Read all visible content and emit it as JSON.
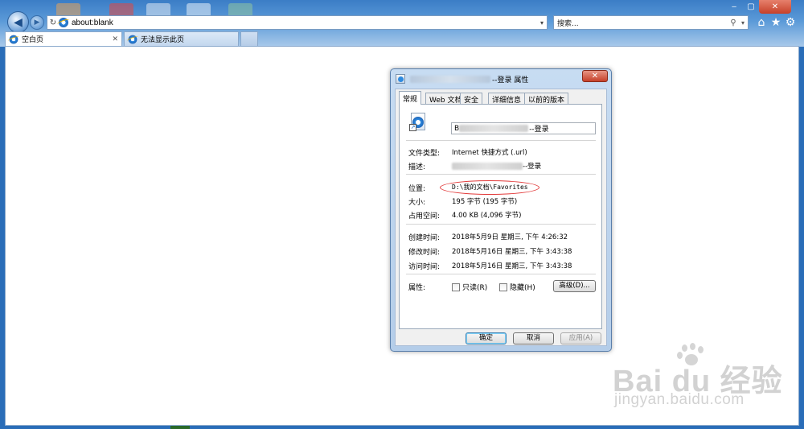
{
  "browser": {
    "address": "about:blank",
    "search_placeholder": "搜索...",
    "tabs": [
      {
        "label": "空白页"
      },
      {
        "label": "无法显示此页"
      }
    ],
    "window_controls": {
      "min": "‒",
      "max": "▢",
      "close": "✕"
    }
  },
  "dialog": {
    "title_suffix": "--登录 属性",
    "tabs": [
      "常规",
      "Web 文档",
      "安全",
      "详细信息",
      "以前的版本"
    ],
    "file_name_prefix": "B",
    "file_name_suffix": "--登录",
    "rows": {
      "type_label": "文件类型:",
      "type_value": "Internet 快捷方式 (.url)",
      "desc_label": "描述:",
      "desc_suffix": "--登录",
      "location_label": "位置:",
      "location_value": "D:\\我的文档\\Favorites",
      "size_label": "大小:",
      "size_value": "195 字节 (195 字节)",
      "disk_label": "占用空间:",
      "disk_value": "4.00 KB (4,096 字节)",
      "created_label": "创建时间:",
      "created_value": "2018年5月9日 星期三, 下午 4:26:32",
      "modified_label": "修改时间:",
      "modified_value": "2018年5月16日 星期三, 下午 3:43:38",
      "accessed_label": "访问时间:",
      "accessed_value": "2018年5月16日 星期三, 下午 3:43:38",
      "attr_label": "属性:"
    },
    "checkboxes": {
      "readonly": "只读(R)",
      "hidden": "隐藏(H)"
    },
    "advanced_button": "高级(D)...",
    "buttons": {
      "ok": "确定",
      "cancel": "取消",
      "apply": "应用(A)"
    }
  },
  "watermark": {
    "brand": "Bai du 经验",
    "url": "jingyan.baidu.com"
  }
}
